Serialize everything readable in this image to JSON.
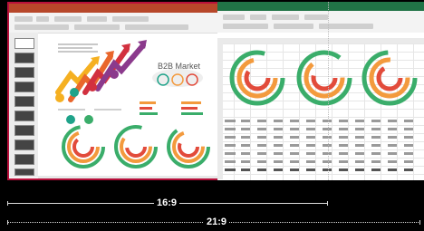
{
  "slide": {
    "title": "B2B Market"
  },
  "measures": {
    "ratio_16_9": "16:9",
    "ratio_21_9": "21:9"
  },
  "colors": {
    "powerpoint_accent": "#b7472a",
    "selection_border": "#b7103b",
    "excel_accent": "#217346",
    "ring_green": "#3aad6a",
    "ring_orange": "#f39a3d",
    "ring_red": "#e24b3b"
  }
}
